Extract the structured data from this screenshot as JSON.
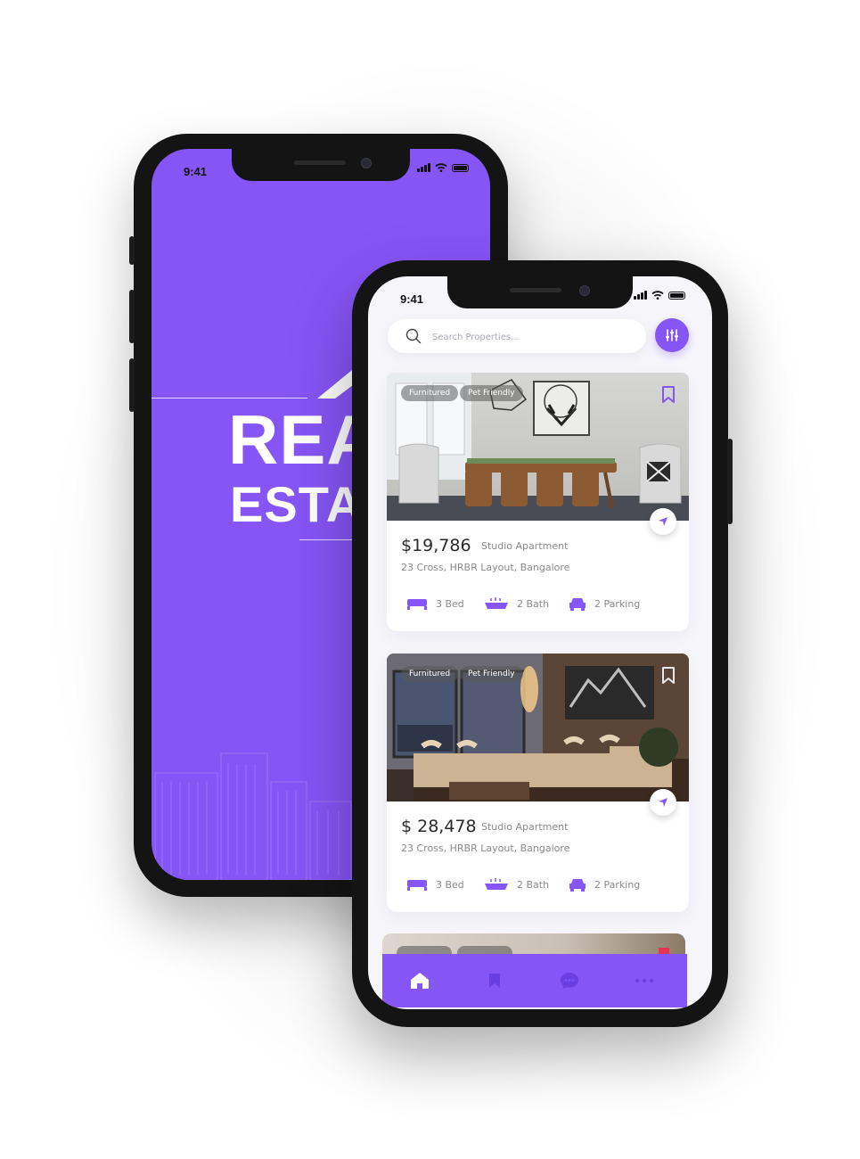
{
  "back_phone": {
    "status_time": "9:41",
    "brand": {
      "line1": "REA",
      "line2": "ESTA"
    }
  },
  "front_phone": {
    "status_time": "9:41",
    "search": {
      "placeholder": "Search Properties..."
    },
    "listings": [
      {
        "tags": [
          "Furnitured",
          "Pet Friendly"
        ],
        "price": "$19,786",
        "type": "Studio Apartment",
        "address": "23 Cross, HRBR Layout, Bangalore",
        "bed": "3 Bed",
        "bath": "2 Bath",
        "parking": "2 Parking",
        "saved": true
      },
      {
        "tags": [
          "Furnitured",
          "Pet Friendly"
        ],
        "price": "$ 28,478",
        "type": "Studio Apartment",
        "address": "23 Cross, HRBR Layout, Bangalore",
        "bed": "3 Bed",
        "bath": "2 Bath",
        "parking": "2 Parking",
        "saved": false
      }
    ],
    "bottom_nav": [
      "home-icon",
      "bookmark-icon",
      "chat-icon",
      "more-icon"
    ]
  },
  "colors": {
    "accent": "#8655f6",
    "frame": "#141414",
    "background": "#f6f6fa"
  }
}
